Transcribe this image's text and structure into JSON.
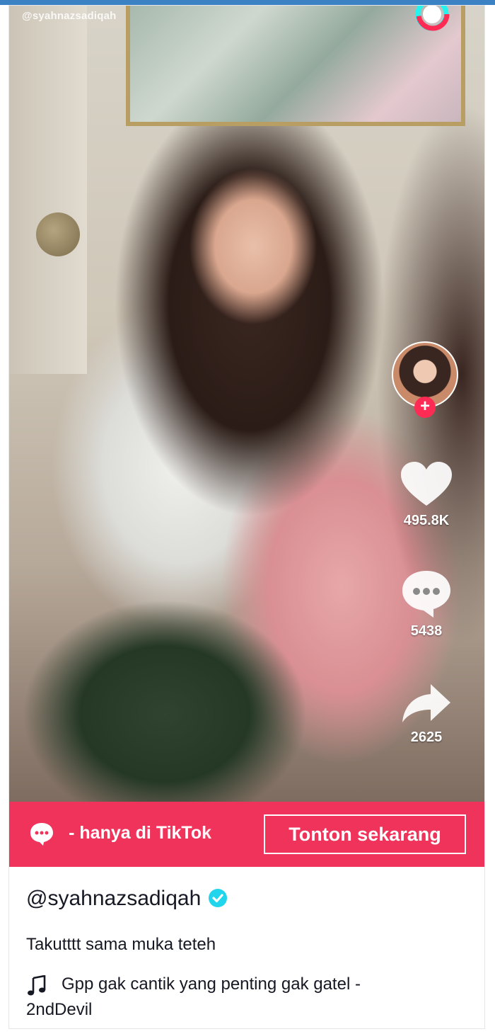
{
  "watermark": "@syahnazsadiqah",
  "side": {
    "likes": "495.8K",
    "comments": "5438",
    "shares": "2625"
  },
  "banner": {
    "text": "ah - hanya di TikTok",
    "cta": "Tonton sekarang"
  },
  "post": {
    "username": "@syahnazsadiqah",
    "caption": "Takutttt sama muka teteh",
    "music_line1": "Gpp gak cantik yang penting gak gatel -",
    "music_line2": "2ndDevil"
  },
  "colors": {
    "accent": "#f0335a",
    "follow": "#fe2c55",
    "verified": "#20d5ec",
    "text": "#161823"
  },
  "icons": [
    "tiktok-logo-icon",
    "plus-icon",
    "heart-icon",
    "comment-icon",
    "share-icon",
    "chat-bubble-icon",
    "verified-icon",
    "music-note-icon"
  ]
}
